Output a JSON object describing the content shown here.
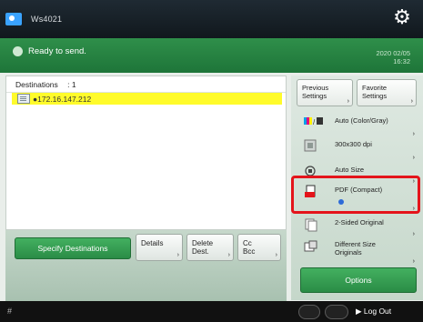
{
  "topbar": {
    "user_name": "Ws4021",
    "settings_icon": "gear-icon",
    "user_icon": "user-icon"
  },
  "status": {
    "message": "Ready to send.",
    "date": "2020 02/05",
    "time": "16:32"
  },
  "destinations": {
    "header_label": "Destinations",
    "count": ": 1",
    "rows": [
      {
        "text": "●172.16.147.212"
      }
    ]
  },
  "left_buttons": {
    "specify": "Specify Destinations",
    "details": "Details",
    "delete": "Delete\nDest.",
    "cc_bcc": "Cc\nBcc"
  },
  "right_panel": {
    "previous_settings": "Previous\nSettings",
    "favorite_settings": "Favorite\nSettings",
    "settings": [
      {
        "label": "Auto (Color/Gray)",
        "icon": "color-mode-icon"
      },
      {
        "label": "300x300 dpi",
        "icon": "resolution-icon"
      },
      {
        "label": "Auto Size",
        "icon": "scan-size-icon"
      },
      {
        "label": "PDF (Compact)",
        "icon": "pdf-icon"
      },
      {
        "label": "2-Sided Original",
        "icon": "two-sided-icon"
      },
      {
        "label": "Different Size\nOriginals",
        "icon": "different-size-icon"
      }
    ],
    "options": "Options"
  },
  "bottombar": {
    "left_icon": "#",
    "logout": "Log Out"
  },
  "colors": {
    "status_green": "#2f8f4a",
    "highlight_red": "#e4141b",
    "selected_yellow": "#fffb2b"
  }
}
